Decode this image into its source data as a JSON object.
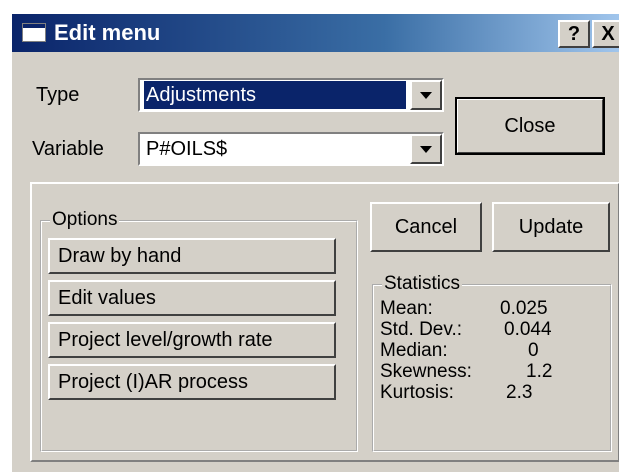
{
  "window": {
    "title": "Edit menu",
    "help_label": "?",
    "close_label": "X"
  },
  "form": {
    "type_label": "Type",
    "type_value": "Adjustments",
    "variable_label": "Variable",
    "variable_value": "P#OILS$",
    "close_button": "Close"
  },
  "options": {
    "legend": "Options",
    "items": [
      "Draw by hand",
      "Edit values",
      "Project level/growth rate",
      "Project (I)AR process"
    ]
  },
  "actions": {
    "cancel": "Cancel",
    "update": "Update"
  },
  "statistics": {
    "legend": "Statistics",
    "rows": [
      {
        "label": "Mean:",
        "value": "0.025"
      },
      {
        "label": "Std. Dev.:",
        "value": "0.044"
      },
      {
        "label": "Median:",
        "value": "0"
      },
      {
        "label": "Skewness:",
        "value": "1.2"
      },
      {
        "label": "Kurtosis:",
        "value": "2.3"
      }
    ]
  },
  "colors": {
    "titlebar_start": "#0a246a",
    "titlebar_end": "#a6caf0",
    "face": "#d4d0c8",
    "selection": "#0a246a"
  }
}
